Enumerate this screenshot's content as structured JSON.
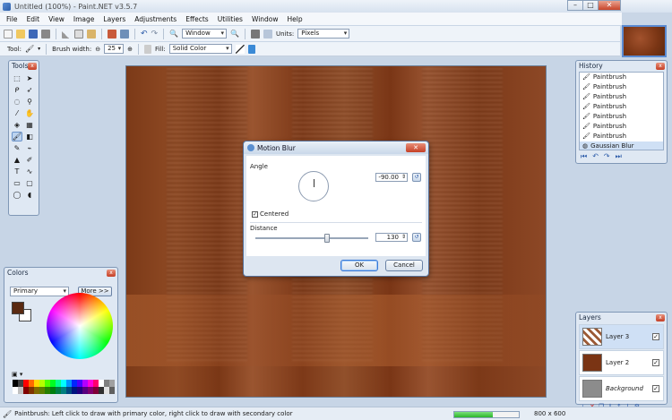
{
  "window": {
    "title": "Untitled (100%) - Paint.NET v3.5.7",
    "min_label": "–",
    "max_label": "□",
    "close_label": "✕"
  },
  "menu": [
    "File",
    "Edit",
    "View",
    "Image",
    "Layers",
    "Adjustments",
    "Effects",
    "Utilities",
    "Window",
    "Help"
  ],
  "toolbar": {
    "zoom_value": "Window",
    "units_label": "Units:",
    "units_value": "Pixels",
    "tool_label": "Tool:",
    "brush_width_label": "Brush width:",
    "brush_width_value": "25",
    "fill_label": "Fill:",
    "fill_value": "Solid Color"
  },
  "tools_panel": {
    "title": "Tools"
  },
  "history_panel": {
    "title": "History",
    "items": [
      "Paintbrush",
      "Paintbrush",
      "Paintbrush",
      "Paintbrush",
      "Paintbrush",
      "Paintbrush",
      "Paintbrush",
      "Paintbrush",
      "Gaussian Blur"
    ],
    "selected": "Gaussian Blur"
  },
  "colors_panel": {
    "title": "Colors",
    "mode_value": "Primary",
    "more_label": "More >>",
    "primary_color": "#5a2a12",
    "secondary_color": "#ffffff"
  },
  "layers_panel": {
    "title": "Layers",
    "layers": [
      {
        "name": "Layer 3",
        "checked": true
      },
      {
        "name": "Layer 2",
        "checked": true
      },
      {
        "name": "Background",
        "checked": true
      }
    ]
  },
  "dialog": {
    "title": "Motion Blur",
    "angle_label": "Angle",
    "angle_value": "-90.00",
    "centered_label": "Centered",
    "distance_label": "Distance",
    "distance_value": "130",
    "ok_label": "OK",
    "cancel_label": "Cancel"
  },
  "status": {
    "message": "Paintbrush: Left click to draw with primary color, right click to draw with secondary color",
    "image_size": "800 x 600",
    "progress_fraction": 0.6
  }
}
